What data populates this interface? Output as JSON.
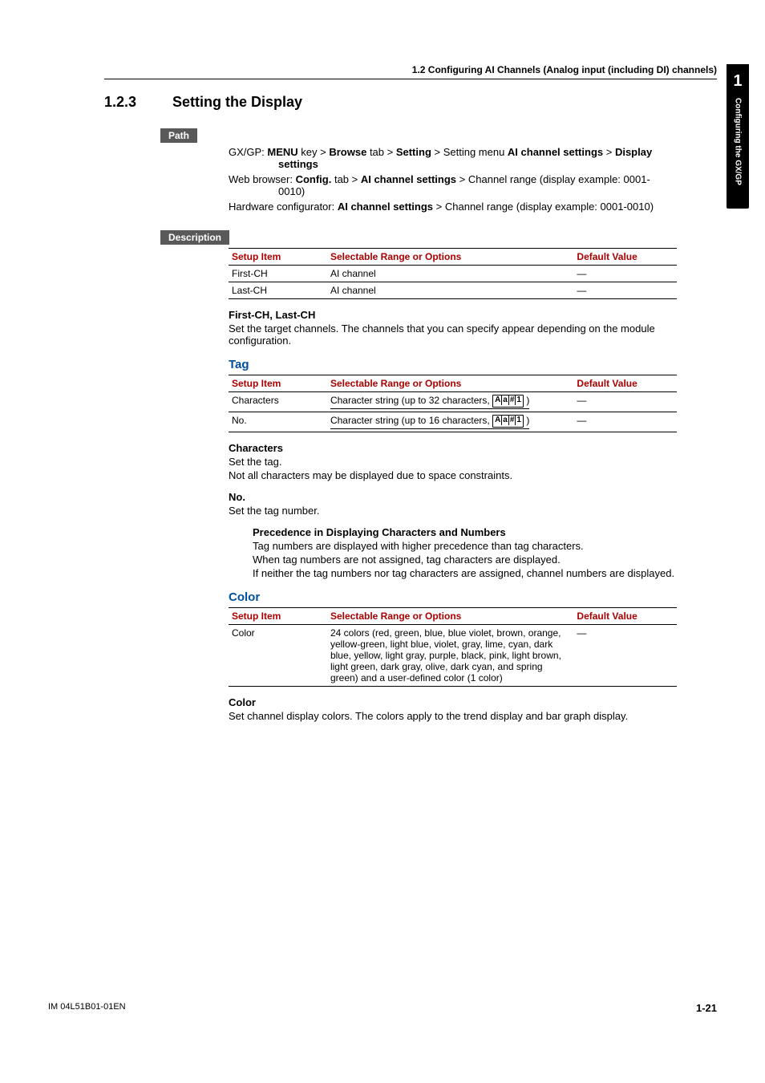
{
  "side_tab": {
    "number": "1",
    "text": "Configuring the GX/GP"
  },
  "header": {
    "line": "1.2  Configuring AI Channels (Analog input (including DI) channels)"
  },
  "section": {
    "num": "1.2.3",
    "title": "Setting the Display"
  },
  "labels": {
    "path": "Path",
    "description": "Description"
  },
  "path": {
    "p1a": "GX/GP: ",
    "p1b": "MENU",
    "p1c": " key > ",
    "p1d": "Browse",
    "p1e": " tab > ",
    "p1f": "Setting",
    "p1g": " > Setting menu ",
    "p1h": "AI channel settings",
    "p1i": " > ",
    "p1j": "Display",
    "p1k": "settings",
    "p2a": "Web browser: ",
    "p2b": "Config.",
    "p2c": " tab > ",
    "p2d": "AI channel settings",
    "p2e": " > Channel range (display example: 0001-",
    "p2f": "0010)",
    "p3a": "Hardware configurator: ",
    "p3b": "AI channel settings",
    "p3c": " > Channel range (display example: 0001-0010)"
  },
  "table1_head": {
    "a": "Setup Item",
    "b": "Selectable Range or Options",
    "c": "Default Value"
  },
  "table1": [
    {
      "a": "First-CH",
      "b": "AI channel",
      "c": "—"
    },
    {
      "a": "Last-CH",
      "b": "AI channel",
      "c": "—"
    }
  ],
  "firstlast": {
    "title": "First-CH, Last-CH",
    "body": "Set the target channels. The channels that you can specify appear depending on the module configuration."
  },
  "tag": {
    "title": "Tag",
    "head": {
      "a": "Setup Item",
      "b": "Selectable Range or Options",
      "c": "Default Value"
    },
    "rows": [
      {
        "a": "Characters",
        "b": "Character string (up to 32 characters, ",
        "c": "—"
      },
      {
        "a": "No.",
        "b": "Character string (up to 16 characters, ",
        "c": "—"
      }
    ],
    "key_A": "A",
    "key_a": "a",
    "key_h": "#",
    "key_1": "1",
    "close_paren": ")",
    "chars_title": "Characters",
    "chars_l1": "Set the tag.",
    "chars_l2": "Not all characters may be displayed due to space constraints.",
    "no_title": "No.",
    "no_l1": "Set the tag number.",
    "prec_title": "Precedence in Displaying Characters and Numbers",
    "prec_l1": "Tag numbers are displayed with higher precedence than tag characters.",
    "prec_l2": "When tag numbers are not assigned, tag characters are displayed.",
    "prec_l3": "If neither the tag numbers nor tag characters are assigned, channel numbers are displayed."
  },
  "color": {
    "title": "Color",
    "head": {
      "a": "Setup Item",
      "b": "Selectable Range or Options",
      "c": "Default Value"
    },
    "row": {
      "a": "Color",
      "b": "24 colors (red, green, blue, blue violet, brown, orange, yellow-green, light blue, violet, gray, lime, cyan, dark blue, yellow, light gray, purple, black, pink, light brown, light green, dark gray, olive, dark cyan, and spring green) and a user-defined color (1 color)",
      "c": "—"
    },
    "sub_title": "Color",
    "sub_body": "Set channel display colors. The colors apply to the trend display and bar graph display."
  },
  "footer": {
    "left": "IM 04L51B01-01EN",
    "right": "1-21"
  }
}
